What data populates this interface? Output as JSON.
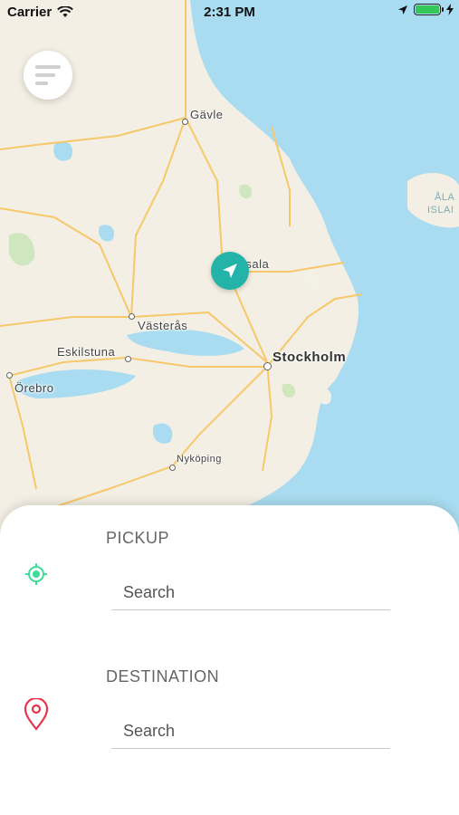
{
  "status_bar": {
    "carrier": "Carrier",
    "time": "2:31 PM",
    "battery_level": 1.0
  },
  "map": {
    "cities": [
      {
        "name": "Gävle"
      },
      {
        "name": "Uppsala"
      },
      {
        "name": "Västerås"
      },
      {
        "name": "Eskilstuna"
      },
      {
        "name": "Stockholm"
      },
      {
        "name": "Örebro"
      },
      {
        "name": "Nyköping"
      }
    ],
    "sea_label_1": "ÅLA",
    "sea_label_2": "ISLAI",
    "colors": {
      "land": "#f3efe4",
      "water": "#a9dcf0",
      "road": "#f6c86a",
      "accent": "#23b3a8"
    }
  },
  "menu_button_icon": "menu-lines-icon",
  "locate_button_icon": "navigation-arrow-icon",
  "form": {
    "pickup": {
      "label": "PICKUP",
      "placeholder": "Search",
      "icon": "target-location-icon",
      "icon_color": "#3ddc97"
    },
    "destination": {
      "label": "DESTINATION",
      "placeholder": "Search",
      "icon": "map-pin-icon",
      "icon_color": "#e8344e"
    }
  }
}
